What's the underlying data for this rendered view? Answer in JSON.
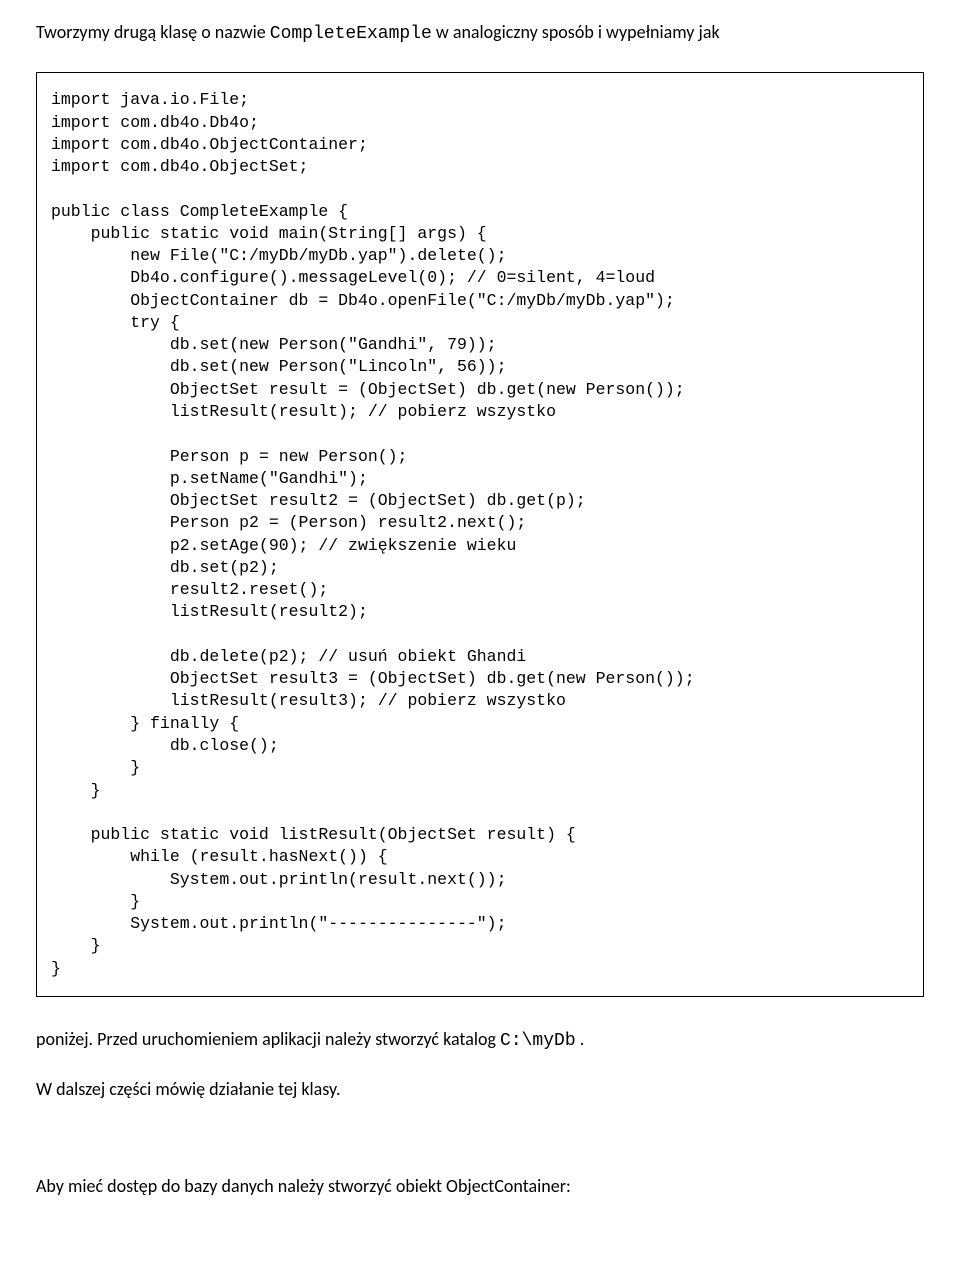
{
  "intro": {
    "before": "Tworzymy drugą klasę o nazwie ",
    "classname": "CompleteExample",
    "after": " w analogiczny sposób i wypełniamy jak"
  },
  "code": "import java.io.File;\nimport com.db4o.Db4o;\nimport com.db4o.ObjectContainer;\nimport com.db4o.ObjectSet;\n\npublic class CompleteExample {\n    public static void main(String[] args) {\n        new File(\"C:/myDb/myDb.yap\").delete();\n        Db4o.configure().messageLevel(0); // 0=silent, 4=loud\n        ObjectContainer db = Db4o.openFile(\"C:/myDb/myDb.yap\");\n        try {\n            db.set(new Person(\"Gandhi\", 79));\n            db.set(new Person(\"Lincoln\", 56));\n            ObjectSet result = (ObjectSet) db.get(new Person());\n            listResult(result); // pobierz wszystko\n\n            Person p = new Person();\n            p.setName(\"Gandhi\");\n            ObjectSet result2 = (ObjectSet) db.get(p);\n            Person p2 = (Person) result2.next();\n            p2.setAge(90); // zwiększenie wieku\n            db.set(p2);\n            result2.reset();\n            listResult(result2);\n\n            db.delete(p2); // usuń obiekt Ghandi\n            ObjectSet result3 = (ObjectSet) db.get(new Person());\n            listResult(result3); // pobierz wszystko\n        } finally {\n            db.close();\n        }\n    }\n\n    public static void listResult(ObjectSet result) {\n        while (result.hasNext()) {\n            System.out.println(result.next());\n        }\n        System.out.println(\"---------------\");\n    }\n}",
  "below": {
    "p1_before": "poniżej. Przed uruchomieniem aplikacji należy stworzyć katalog ",
    "p1_path": "C:\\myDb",
    "p1_after": " .",
    "p2": "W dalszej części mówię działanie tej klasy.",
    "p3": "Aby mieć dostęp do bazy danych należy stworzyć obiekt ObjectContainer:"
  }
}
